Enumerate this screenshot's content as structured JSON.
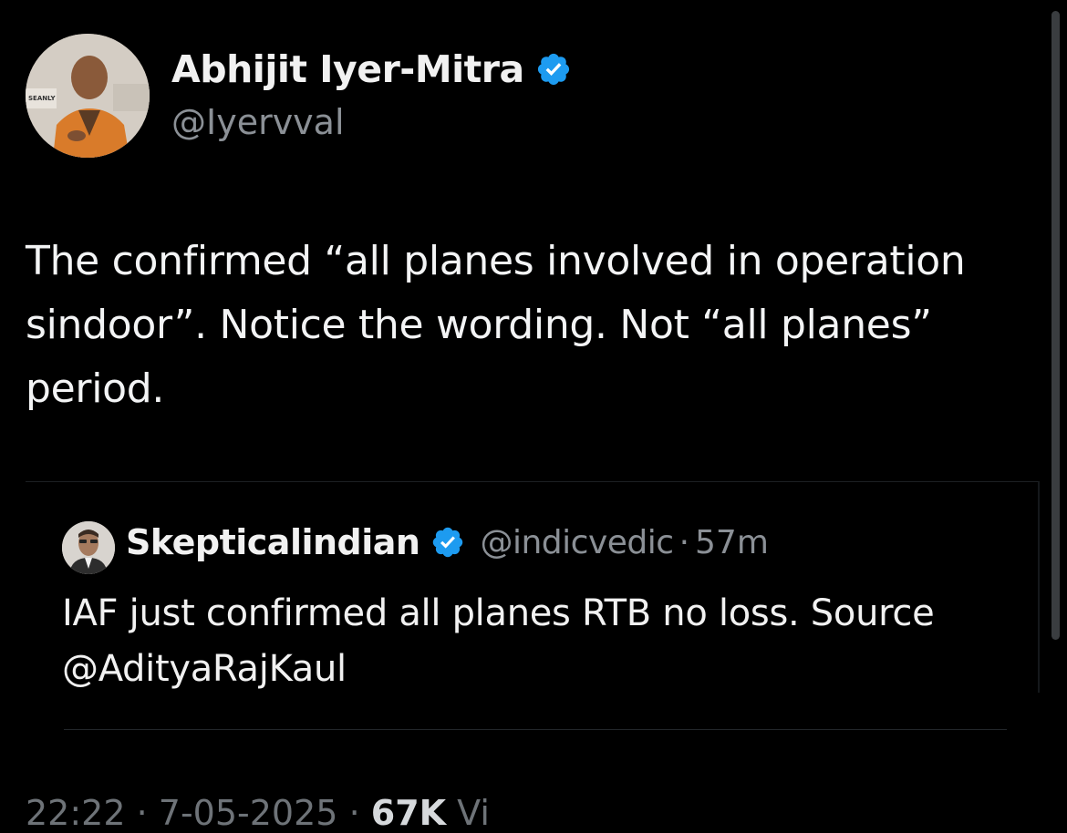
{
  "tweet": {
    "author_name": "Abhijit Iyer-Mitra",
    "author_handle": "@Iyervval",
    "text": "The confirmed “all planes involved in operation sindoor”. Notice the wording. Not “all planes” period."
  },
  "quoted_tweet": {
    "author_name": "Skepticalindian",
    "author_handle": "@indicvedic",
    "separator": "·",
    "time": "57m",
    "text_line1": "IAF just confirmed all planes RTB no loss. Source",
    "text_line2": "@AdityaRajKaul"
  },
  "meta": {
    "time": "22:22",
    "separator": "·",
    "date": "7-05-2025",
    "views_count": "67K",
    "views_label": "Vi"
  },
  "avatar_badge_text": "SEANLY",
  "icons": {
    "verified": "verified-badge-icon",
    "verified_color": "#1d9bf0"
  }
}
